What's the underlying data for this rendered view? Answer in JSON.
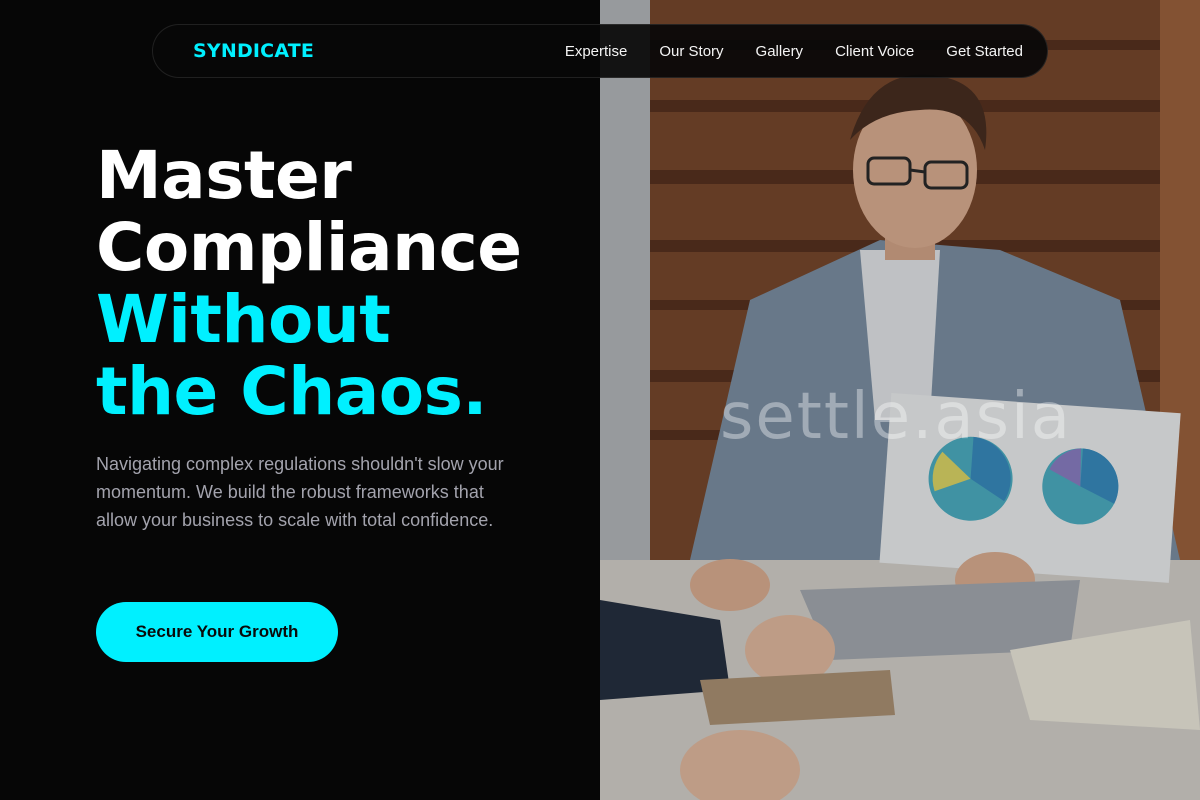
{
  "colors": {
    "accent": "#00f0ff",
    "background": "#060606",
    "text_primary": "#ffffff",
    "text_muted": "#a3a3ad"
  },
  "nav": {
    "logo": "SYNDICATE",
    "links": [
      "Expertise",
      "Our Story",
      "Gallery",
      "Client Voice",
      "Get Started"
    ]
  },
  "hero": {
    "title_lines": [
      "Master",
      "Compliance"
    ],
    "title_accent_lines": [
      "Without",
      "the Chaos."
    ],
    "subtitle": "Navigating complex regulations shouldn't slow your momentum. We build the robust frameworks that allow your business to scale with total confidence.",
    "cta_label": "Secure Your Growth"
  },
  "image": {
    "description_icon": "business-meeting-photo",
    "watermark": "settle.asia"
  }
}
